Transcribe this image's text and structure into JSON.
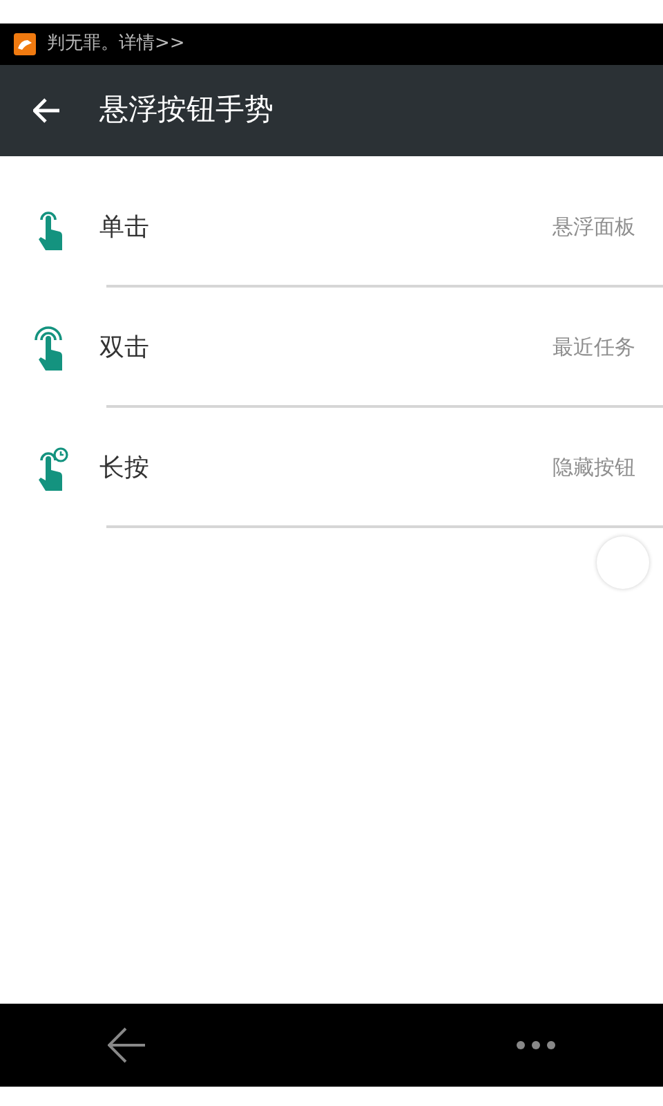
{
  "status_bar": {
    "notification": "判无罪。详情>>"
  },
  "toolbar": {
    "title": "悬浮按钮手势"
  },
  "gestures": [
    {
      "kind": "single",
      "label": "单击",
      "action": "悬浮面板"
    },
    {
      "kind": "double",
      "label": "双击",
      "action": "最近任务"
    },
    {
      "kind": "long",
      "label": "长按",
      "action": "隐藏按钮"
    }
  ]
}
